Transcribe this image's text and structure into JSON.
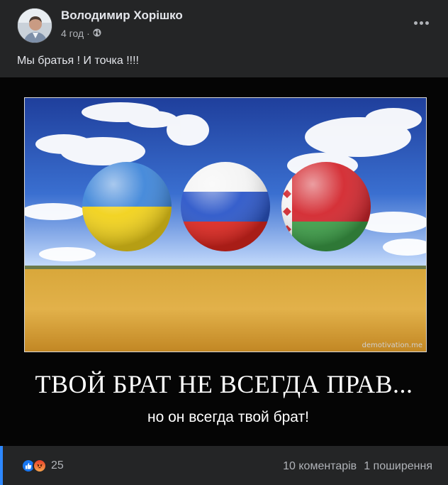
{
  "post": {
    "author": "Володимир Хорішко",
    "time": "4 год",
    "separator": "·",
    "caption": "Мы братья ! И точка !!!!",
    "image": {
      "headline": "ТВОЙ БРАТ НЕ ВСЕГДА ПРАВ...",
      "subline": "но он всегда твой брат!",
      "watermark": "demotivation.me"
    },
    "reactions_count": "25",
    "comments": "10 коментарів",
    "shares": "1 поширення"
  },
  "colors": {
    "background": "#242526",
    "accent": "#2d88ff",
    "like": "#1877f2",
    "angry": "#f7714c"
  },
  "icons": {
    "privacy": "globe-icon",
    "menu": "more-icon",
    "like": "like-icon",
    "angry": "angry-icon"
  }
}
